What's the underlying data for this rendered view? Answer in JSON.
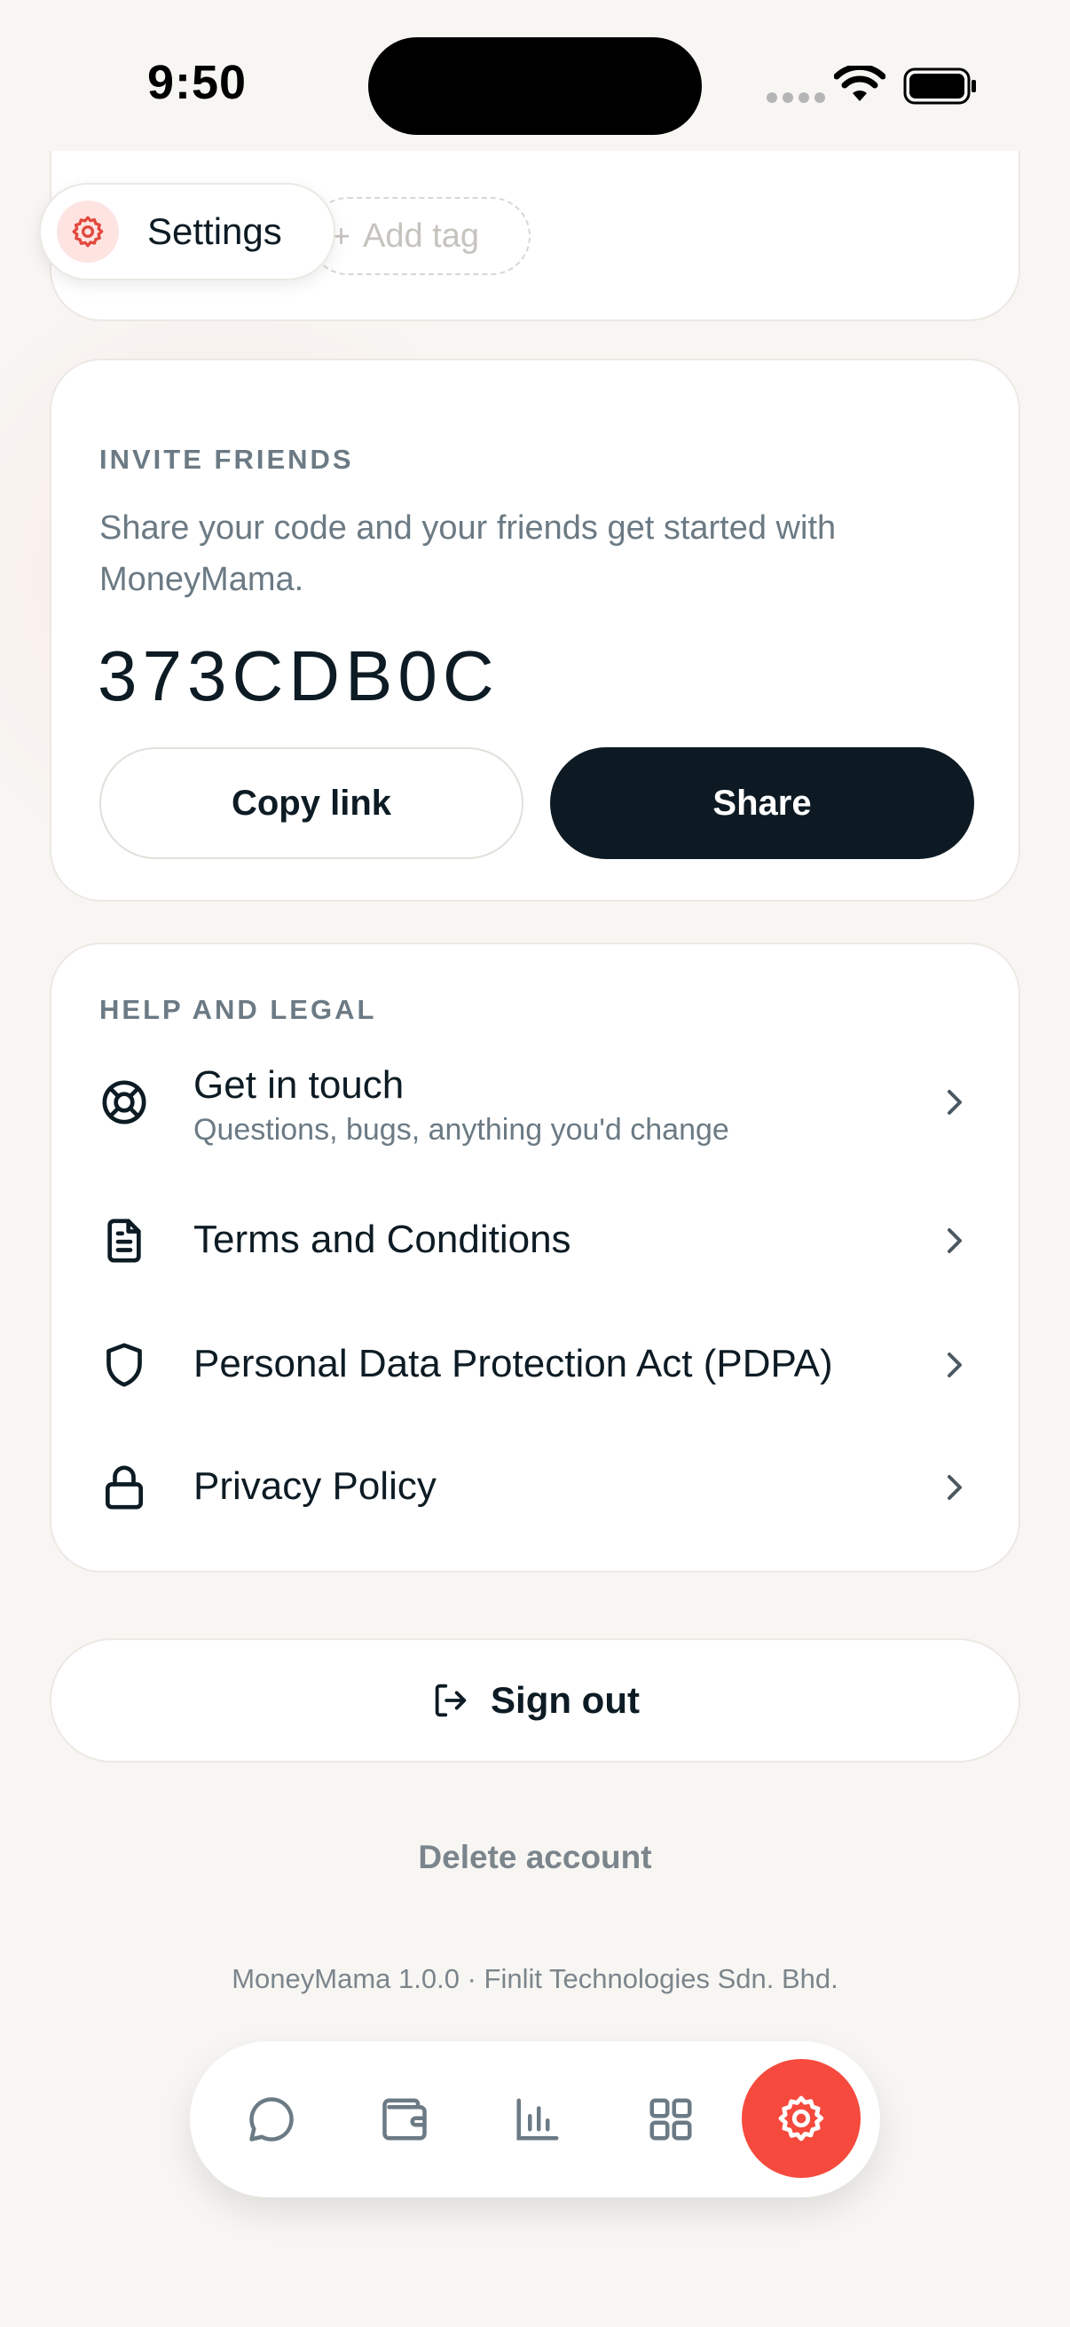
{
  "status_bar": {
    "time": "9:50"
  },
  "header": {
    "title": "Settings",
    "add_tag_label": "Add tag"
  },
  "invite": {
    "section_label": "INVITE FRIENDS",
    "description": "Share your code and your friends get started with MoneyMama.",
    "code": "373CDB0C",
    "copy_label": "Copy link",
    "share_label": "Share"
  },
  "help": {
    "section_label": "HELP AND LEGAL",
    "items": [
      {
        "title": "Get in touch",
        "subtitle": "Questions, bugs, anything you'd change",
        "icon": "lifebuoy-icon"
      },
      {
        "title": "Terms and Conditions",
        "icon": "document-icon"
      },
      {
        "title": "Personal Data Protection Act (PDPA)",
        "icon": "shield-icon"
      },
      {
        "title": "Privacy Policy",
        "icon": "lock-icon"
      }
    ]
  },
  "signout_label": "Sign out",
  "delete_label": "Delete account",
  "footer_text": "MoneyMama 1.0.0 · Finlit Technologies Sdn. Bhd.",
  "tabbar": {
    "items": [
      "chat-icon",
      "wallet-icon",
      "chart-icon",
      "grid-icon",
      "gear-icon"
    ],
    "active": "gear-icon"
  },
  "colors": {
    "accent": "#f54a3d",
    "dark_button": "#0d1a23",
    "muted_text": "#6b7a84",
    "background": "#f8f6f3"
  }
}
